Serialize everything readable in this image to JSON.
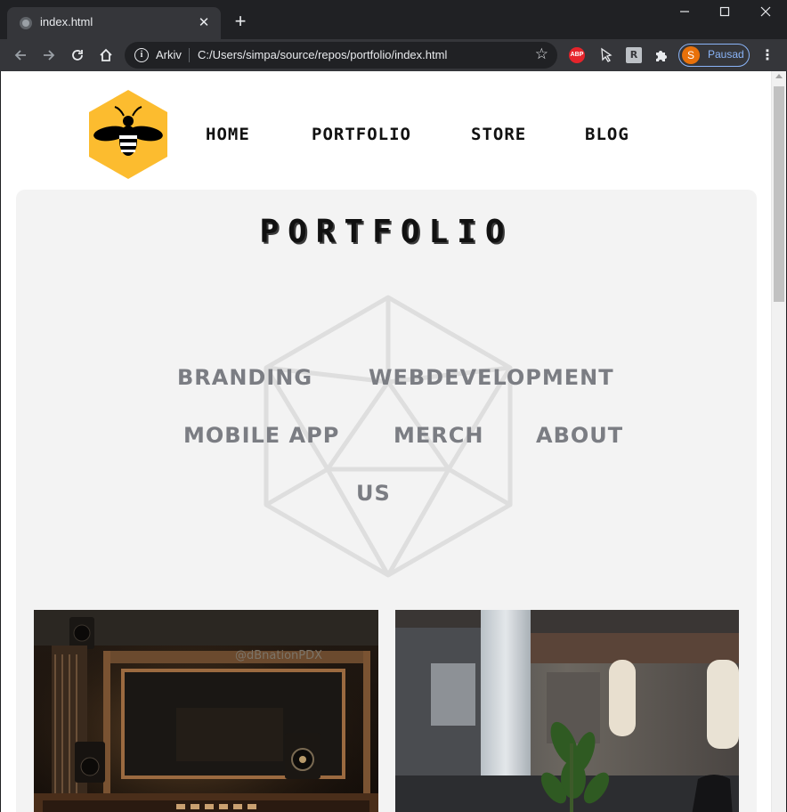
{
  "browser": {
    "tab_title": "index.html",
    "tab_close": "✕",
    "new_tab": "+",
    "omnibox_security_label": "Arkiv",
    "url": "C:/Users/simpa/source/repos/portfolio/index.html",
    "star": "☆",
    "extensions": {
      "abp": "ABP",
      "mouse": "🖱",
      "r": "R",
      "puzzle": "✱"
    },
    "profile_initial": "S",
    "profile_label": "Pausad",
    "menu": "⋮",
    "window_controls": {
      "minimize": "—",
      "maximize": "☐",
      "close": "✕"
    }
  },
  "nav": {
    "items": [
      "HOME",
      "PORTFOLIO",
      "STORE",
      "BLOG"
    ]
  },
  "portfolio": {
    "title": "PORTFOLIO",
    "categories": [
      "BRANDING",
      "WEBDEVELOPMENT",
      "MOBILE APP",
      "MERCH",
      "ABOUT",
      "US"
    ]
  },
  "photos": [
    {
      "watermark": "@dBnationPDX"
    },
    {
      "watermark": ""
    }
  ],
  "colors": {
    "logo_yellow": "#fcbc2f",
    "category_gray": "#7b7d83",
    "panel_bg": "#f3f3f3"
  }
}
